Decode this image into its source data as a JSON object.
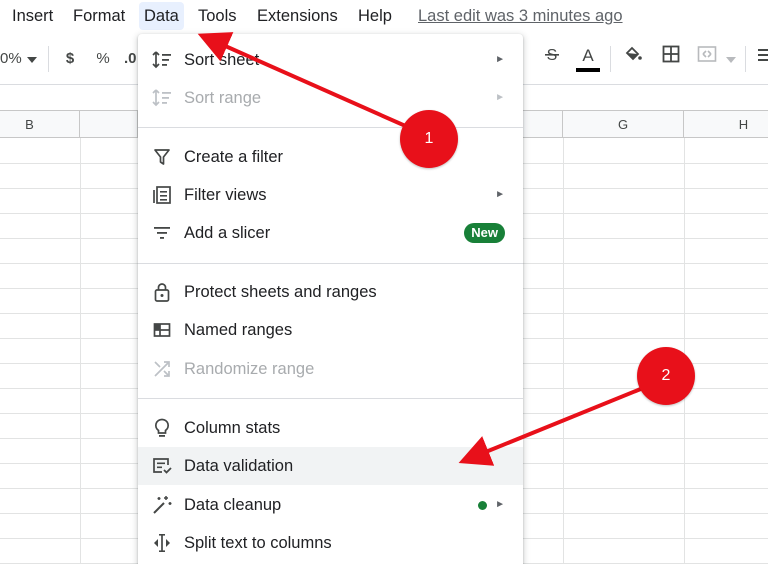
{
  "menubar": {
    "items": [
      "Insert",
      "Format",
      "Data",
      "Tools",
      "Extensions",
      "Help"
    ],
    "last_edit": "Last edit was 3 minutes ago"
  },
  "toolbar": {
    "zoom_partial": "0%",
    "currency": "$",
    "percent": "%",
    "decimal_partial": ".0",
    "text_color_letter": "A"
  },
  "grid": {
    "columns": [
      "B",
      "G",
      "H"
    ]
  },
  "data_menu": {
    "items": [
      {
        "label": "Sort sheet",
        "icon": "sort-icon",
        "submenu": true,
        "disabled": false
      },
      {
        "label": "Sort range",
        "icon": "sort-icon",
        "submenu": true,
        "disabled": true
      },
      {
        "label": "Create a filter",
        "icon": "filter-icon",
        "submenu": false,
        "disabled": false
      },
      {
        "label": "Filter views",
        "icon": "filter-views-icon",
        "submenu": true,
        "disabled": false
      },
      {
        "label": "Add a slicer",
        "icon": "slicer-icon",
        "submenu": false,
        "disabled": false,
        "badge": "New"
      },
      {
        "label": "Protect sheets and ranges",
        "icon": "lock-icon",
        "submenu": false,
        "disabled": false
      },
      {
        "label": "Named ranges",
        "icon": "named-ranges-icon",
        "submenu": false,
        "disabled": false
      },
      {
        "label": "Randomize range",
        "icon": "shuffle-icon",
        "submenu": false,
        "disabled": true
      },
      {
        "label": "Column stats",
        "icon": "lightbulb-icon",
        "submenu": false,
        "disabled": false
      },
      {
        "label": "Data validation",
        "icon": "data-validation-icon",
        "submenu": false,
        "disabled": false,
        "highlighted": true
      },
      {
        "label": "Data cleanup",
        "icon": "magic-wand-icon",
        "submenu": true,
        "disabled": false
      },
      {
        "label": "Split text to columns",
        "icon": "split-icon",
        "submenu": false,
        "disabled": false
      }
    ]
  },
  "callouts": [
    "1",
    "2"
  ],
  "colors": {
    "accent_red": "#e8101a",
    "badge_green": "#188038",
    "active_menu_bg": "#e8f0fe"
  }
}
